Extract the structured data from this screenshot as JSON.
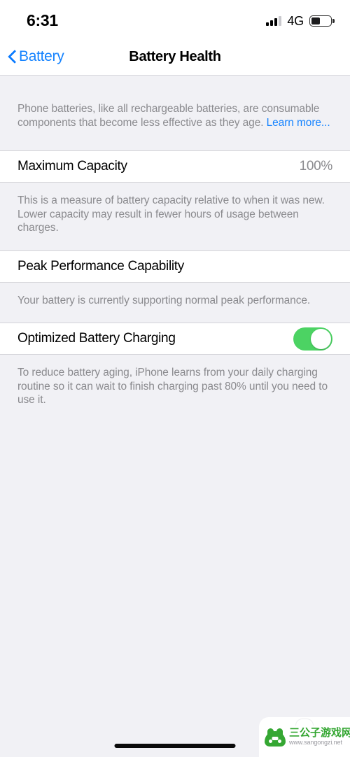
{
  "status_bar": {
    "time": "6:31",
    "network": "4G",
    "signal_icon": "cellular-signal-icon",
    "battery_icon": "battery-icon",
    "battery_level_percent": 45
  },
  "nav": {
    "back_label": "Battery",
    "back_icon": "chevron-left-icon",
    "title": "Battery Health"
  },
  "intro": {
    "text": "Phone batteries, like all rechargeable batteries, are consumable components that become less effective as they age. ",
    "link_text": "Learn more..."
  },
  "maximum_capacity": {
    "label": "Maximum Capacity",
    "value": "100%",
    "footer": "This is a measure of battery capacity relative to when it was new. Lower capacity may result in fewer hours of usage between charges."
  },
  "peak_performance": {
    "label": "Peak Performance Capability",
    "footer": "Your battery is currently supporting normal peak performance."
  },
  "optimized_charging": {
    "label": "Optimized Battery Charging",
    "toggle_state": "on",
    "footer": "To reduce battery aging, iPhone learns from your daily charging routine so it can wait to finish charging past 80% until you need to use it."
  },
  "watermark": {
    "logo_icon": "mascot-logo-icon",
    "title": "三公子游戏网",
    "url": "www.sangongzi.net"
  },
  "colors": {
    "accent_blue": "#1583FF",
    "toggle_green": "#4CD363",
    "brand_green": "#35A733",
    "background_gray": "#F1F1F5",
    "secondary_text": "#8A8A8E"
  }
}
